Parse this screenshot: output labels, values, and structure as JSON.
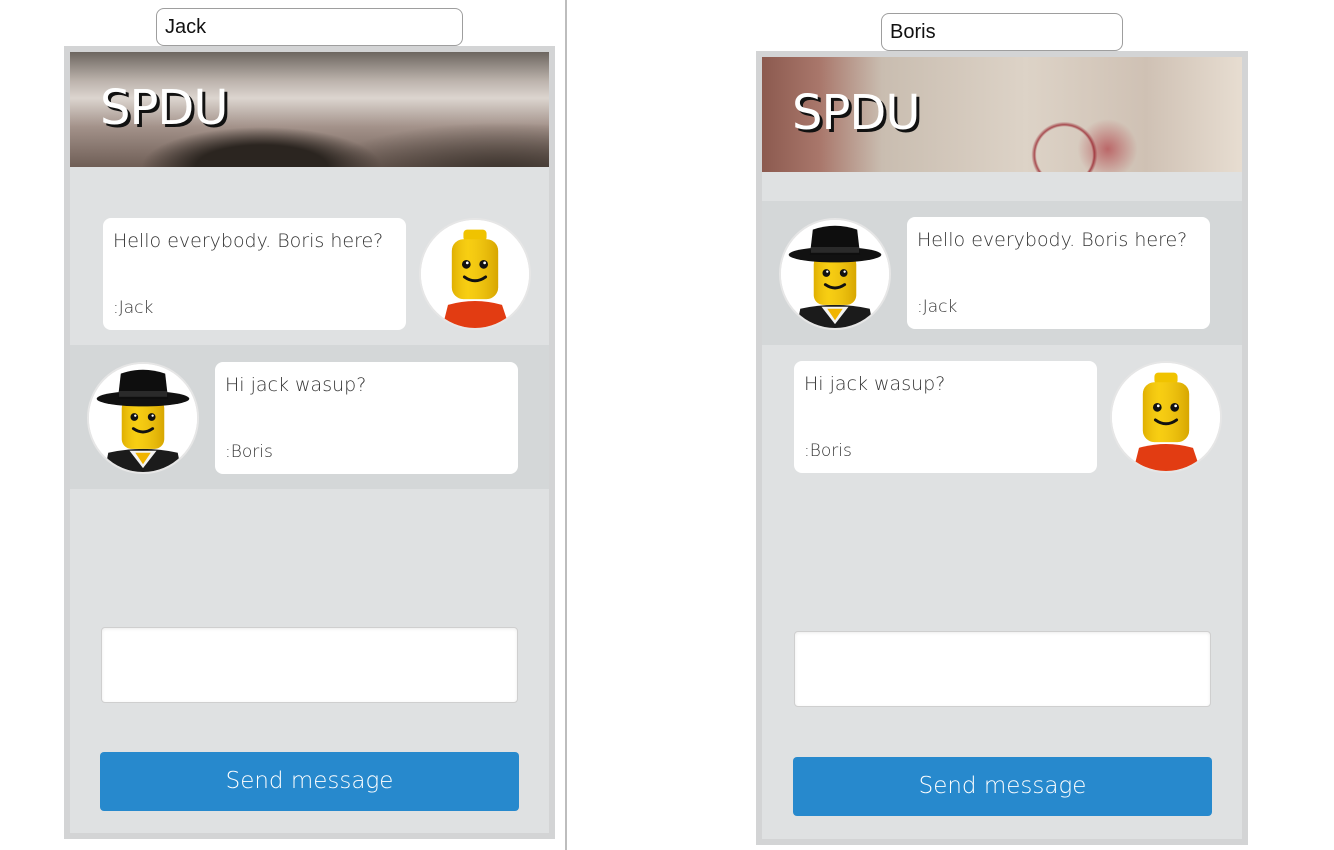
{
  "left_window": {
    "username_input": {
      "value": "Jack"
    },
    "app": {
      "title": "SPDU",
      "messages": [
        {
          "text": "Hello everybody. Boris here?",
          "author": ":Jack",
          "avatar": "lego-smiley-icon"
        },
        {
          "text": "Hi jack wasup?",
          "author": ":Boris",
          "avatar": "lego-hat-icon"
        }
      ],
      "message_input": {
        "value": ""
      },
      "send_label": "Send message"
    }
  },
  "right_window": {
    "username_input": {
      "value": "Boris"
    },
    "app": {
      "title": "SPDU",
      "messages": [
        {
          "text": "Hello everybody. Boris here?",
          "author": ":Jack",
          "avatar": "lego-hat-icon"
        },
        {
          "text": "Hi jack wasup?",
          "author": ":Boris",
          "avatar": "lego-smiley-icon"
        }
      ],
      "message_input": {
        "value": ""
      },
      "send_label": "Send message"
    }
  },
  "colors": {
    "app_background": "#dfe1e2",
    "shaded_row": "#d4d7d8",
    "send_button": "#2789cd",
    "bubble": "#ffffff"
  }
}
